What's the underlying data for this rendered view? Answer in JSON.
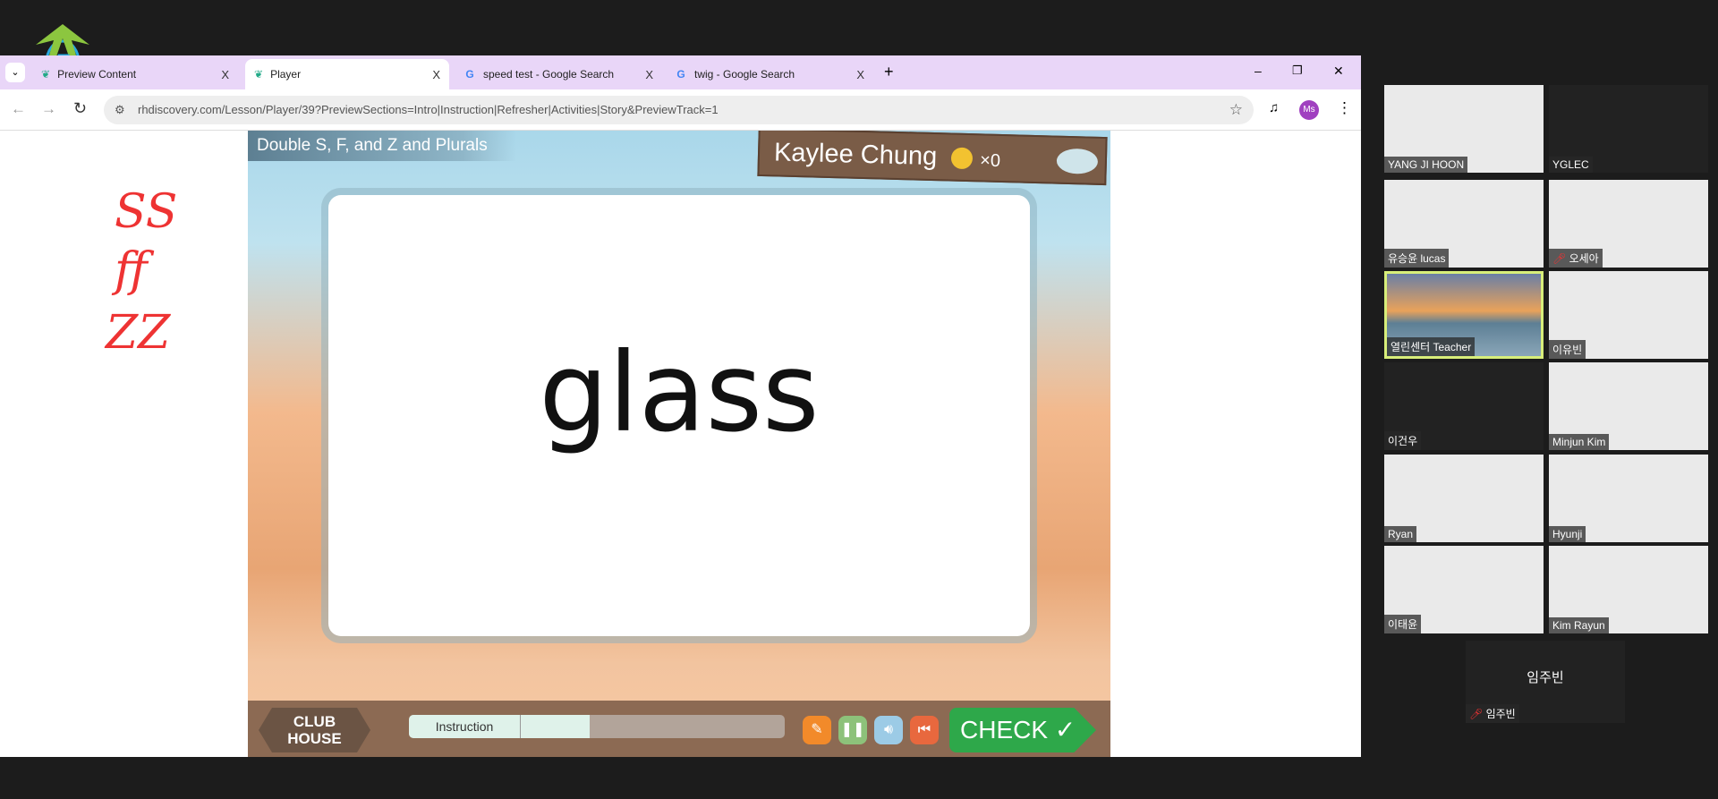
{
  "browser": {
    "tabs": [
      {
        "label": "Preview Content",
        "close": "X"
      },
      {
        "label": "Player",
        "close": "X",
        "active": true
      },
      {
        "label": "speed test - Google Search",
        "close": "X"
      },
      {
        "label": "twig - Google Search",
        "close": "X"
      }
    ],
    "new_tab": "+",
    "url": "rhdiscovery.com/Lesson/Player/39?PreviewSections=Intro|Instruction|Refresher|Activities|Story&PreviewTrack=1",
    "profile": "Ms",
    "window_controls": {
      "minimize": "–",
      "restore": "❐",
      "close": "✕"
    }
  },
  "annotations": [
    "SS",
    "ff",
    "ZZ"
  ],
  "game": {
    "lesson_title": "Double S, F, and Z and Plurals",
    "student_name": "Kaylee Chung",
    "coin_count": "×0",
    "word": "glass",
    "club_house": "CLUB HOUSE",
    "progress_label": "Instruction",
    "progress_fraction": 0.48,
    "check_label": "CHECK ✓"
  },
  "participants": [
    {
      "name": "YANG JI HOON"
    },
    {
      "name": "YGLEC"
    },
    {
      "name": "유승윤 lucas"
    },
    {
      "name": "오세아",
      "muted": true
    },
    {
      "name": "열린센터 Teacher",
      "active": true
    },
    {
      "name": "이유빈"
    },
    {
      "name": "이건우"
    },
    {
      "name": "Minjun Kim"
    },
    {
      "name": "Ryan"
    },
    {
      "name": "Hyunji"
    },
    {
      "name": "이태윤"
    },
    {
      "name": "Kim Rayun"
    },
    {
      "name": "임주빈",
      "muted": true,
      "center_label": "임주빈"
    }
  ],
  "colors": {
    "tabbar": "#e9d6f8",
    "check": "#2ea84a",
    "annotation": "#e33333",
    "active_speaker": "#d8ee7a"
  }
}
